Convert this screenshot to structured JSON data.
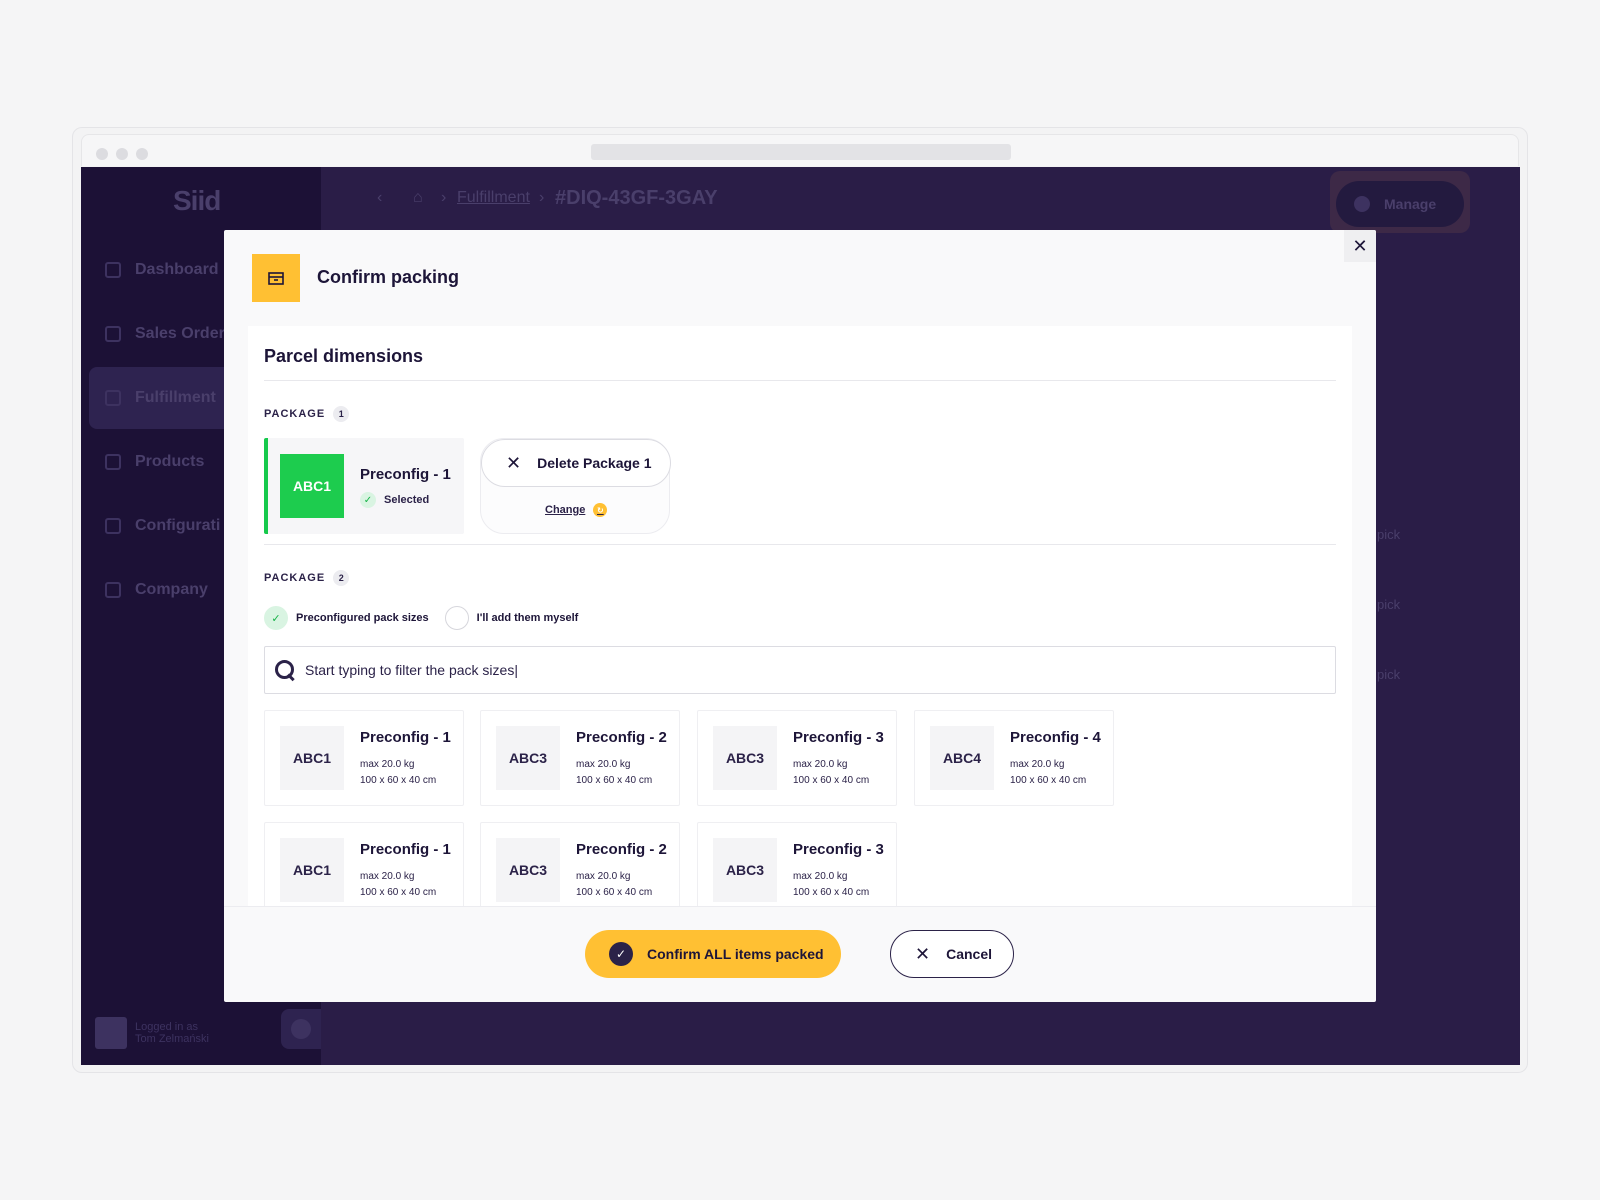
{
  "app": {
    "logo": "Siid",
    "breadcrumb": {
      "section": "Fulfillment",
      "order_id": "#DIQ-43GF-3GAY"
    },
    "manage_label": "Manage",
    "nav": [
      {
        "label": "Dashboard",
        "active": false
      },
      {
        "label": "Sales Order",
        "active": false
      },
      {
        "label": "Fulfillment",
        "active": true
      },
      {
        "label": "Products",
        "active": false
      },
      {
        "label": "Configurati",
        "active": false
      },
      {
        "label": "Company",
        "active": false
      }
    ],
    "user": {
      "caption": "Logged in as",
      "name": "Tom Zelmański"
    },
    "bg_rows": [
      "pick",
      "pick",
      "pick"
    ]
  },
  "modal": {
    "title": "Confirm packing",
    "panel_title": "Parcel dimensions",
    "package1": {
      "label": "PACKAGE",
      "number": "1",
      "selected": {
        "code": "ABC1",
        "name": "Preconfig - 1",
        "status": "Selected"
      },
      "delete_label": "Delete Package 1",
      "change_label": "Change"
    },
    "package2": {
      "label": "PACKAGE",
      "number": "2",
      "options": [
        {
          "label": "Preconfigured pack sizes",
          "checked": true
        },
        {
          "label": "I'll add them myself",
          "checked": false
        }
      ],
      "search_placeholder": "Start typing to filter the pack sizes|",
      "packs": [
        {
          "code": "ABC1",
          "name": "Preconfig - 1",
          "weight": "max 20.0 kg",
          "dims": "100 x 60 x 40 cm"
        },
        {
          "code": "ABC3",
          "name": "Preconfig - 2",
          "weight": "max 20.0 kg",
          "dims": "100 x 60 x 40 cm"
        },
        {
          "code": "ABC3",
          "name": "Preconfig - 3",
          "weight": "max 20.0 kg",
          "dims": "100 x 60 x 40 cm"
        },
        {
          "code": "ABC4",
          "name": "Preconfig - 4",
          "weight": "max 20.0 kg",
          "dims": "100 x 60 x 40 cm"
        },
        {
          "code": "ABC1",
          "name": "Preconfig - 1",
          "weight": "max 20.0 kg",
          "dims": "100 x 60 x 40 cm"
        },
        {
          "code": "ABC3",
          "name": "Preconfig - 2",
          "weight": "max 20.0 kg",
          "dims": "100 x 60 x 40 cm"
        },
        {
          "code": "ABC3",
          "name": "Preconfig - 3",
          "weight": "max 20.0 kg",
          "dims": "100 x 60 x 40 cm"
        }
      ]
    },
    "confirm_label": "Confirm ALL items packed",
    "cancel_label": "Cancel"
  },
  "colors": {
    "accent": "#ffc033",
    "success": "#1dcc4e",
    "ink": "#1d1538",
    "app_bg": "#2a1d47"
  }
}
